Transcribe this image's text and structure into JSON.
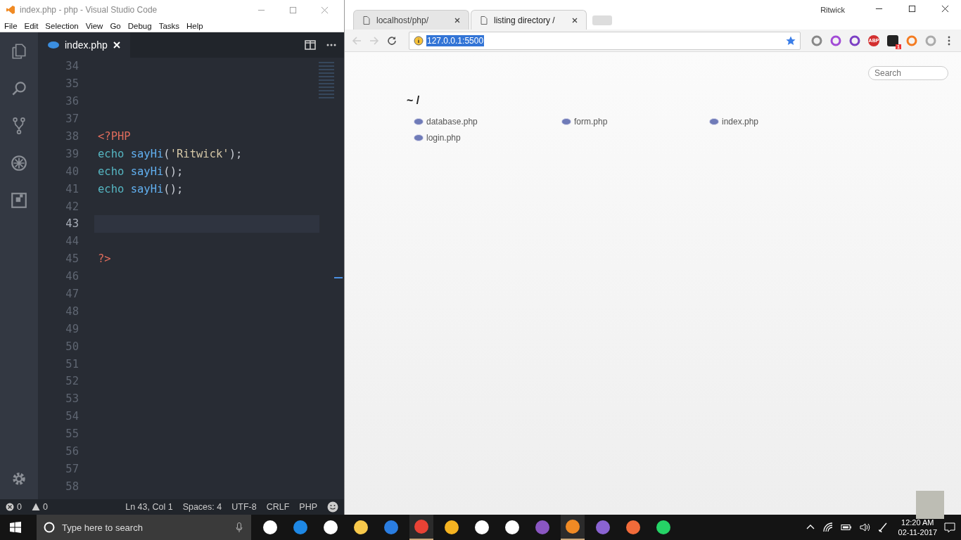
{
  "editor_window": {
    "title": "index.php - php - Visual Studio Code",
    "menu": [
      "File",
      "Edit",
      "Selection",
      "View",
      "Go",
      "Debug",
      "Tasks",
      "Help"
    ],
    "tab": {
      "label": "index.php",
      "selected": true
    },
    "lines": [
      {
        "number": "34",
        "current": false
      },
      {
        "number": "35",
        "current": false
      },
      {
        "number": "36",
        "current": false
      },
      {
        "number": "37",
        "current": false
      },
      {
        "number": "38",
        "current": false,
        "tokens": [
          {
            "kind": "tag",
            "text": "<?PHP"
          }
        ]
      },
      {
        "number": "39",
        "current": false,
        "tokens": [
          {
            "kind": "keyword",
            "text": "echo "
          },
          {
            "kind": "function",
            "text": "sayHi"
          },
          {
            "kind": "punct",
            "text": "("
          },
          {
            "kind": "string",
            "text": "'Ritwick'"
          },
          {
            "kind": "punct",
            "text": ");"
          }
        ]
      },
      {
        "number": "40",
        "current": false,
        "tokens": [
          {
            "kind": "keyword",
            "text": "echo "
          },
          {
            "kind": "function",
            "text": "sayHi"
          },
          {
            "kind": "punct",
            "text": "();"
          }
        ]
      },
      {
        "number": "41",
        "current": false,
        "tokens": [
          {
            "kind": "keyword",
            "text": "echo "
          },
          {
            "kind": "function",
            "text": "sayHi"
          },
          {
            "kind": "punct",
            "text": "();"
          }
        ]
      },
      {
        "number": "42",
        "current": false
      },
      {
        "number": "43",
        "current": true
      },
      {
        "number": "44",
        "current": false
      },
      {
        "number": "45",
        "current": false,
        "tokens": [
          {
            "kind": "tag",
            "text": "?>"
          }
        ]
      },
      {
        "number": "46",
        "current": false
      },
      {
        "number": "47",
        "current": false
      },
      {
        "number": "48",
        "current": false
      },
      {
        "number": "49",
        "current": false
      },
      {
        "number": "50",
        "current": false
      },
      {
        "number": "51",
        "current": false
      },
      {
        "number": "52",
        "current": false
      },
      {
        "number": "53",
        "current": false
      },
      {
        "number": "54",
        "current": false
      },
      {
        "number": "55",
        "current": false
      },
      {
        "number": "56",
        "current": false
      },
      {
        "number": "57",
        "current": false
      },
      {
        "number": "58",
        "current": false
      }
    ],
    "status_bar": {
      "errors": "0",
      "warnings": "0",
      "items": [
        "Ln 43, Col 1",
        "Spaces: 4",
        "UTF-8",
        "CRLF",
        "PHP"
      ]
    }
  },
  "browser": {
    "profile": "Ritwick",
    "tabs": [
      {
        "label": "localhost/php/",
        "selected": false
      },
      {
        "label": "listing directory /",
        "selected": true
      }
    ],
    "url": "127.0.0.1:5500",
    "extensions": [
      {
        "kind": "bird"
      },
      {
        "kind": "cast"
      },
      {
        "kind": "pen"
      },
      {
        "kind": "abp",
        "label": "ABP"
      },
      {
        "kind": "badge",
        "badge": "1"
      },
      {
        "kind": "ring"
      },
      {
        "kind": "page"
      }
    ],
    "search": {
      "placeholder": "Search"
    },
    "heading": "~ /",
    "files": [
      "database.php",
      "form.php",
      "index.php",
      "login.php"
    ]
  },
  "taskbar": {
    "search": {
      "placeholder": "Type here to search"
    },
    "apps": [
      {
        "kind": "taskview",
        "running": false
      },
      {
        "kind": "edge",
        "running": false
      },
      {
        "kind": "store",
        "running": false
      },
      {
        "kind": "folder",
        "running": false
      },
      {
        "kind": "firefox",
        "running": false
      },
      {
        "kind": "chrome",
        "running": true
      },
      {
        "kind": "canary",
        "running": false
      },
      {
        "kind": "disc",
        "running": false
      },
      {
        "kind": "clapper",
        "running": false
      },
      {
        "kind": "github",
        "running": false
      },
      {
        "kind": "vscode",
        "running": true
      },
      {
        "kind": "vs",
        "running": false
      },
      {
        "kind": "postman",
        "running": false
      },
      {
        "kind": "whatsapp",
        "running": false
      }
    ],
    "time": "12:20 AM",
    "date": "02-11-2017"
  }
}
